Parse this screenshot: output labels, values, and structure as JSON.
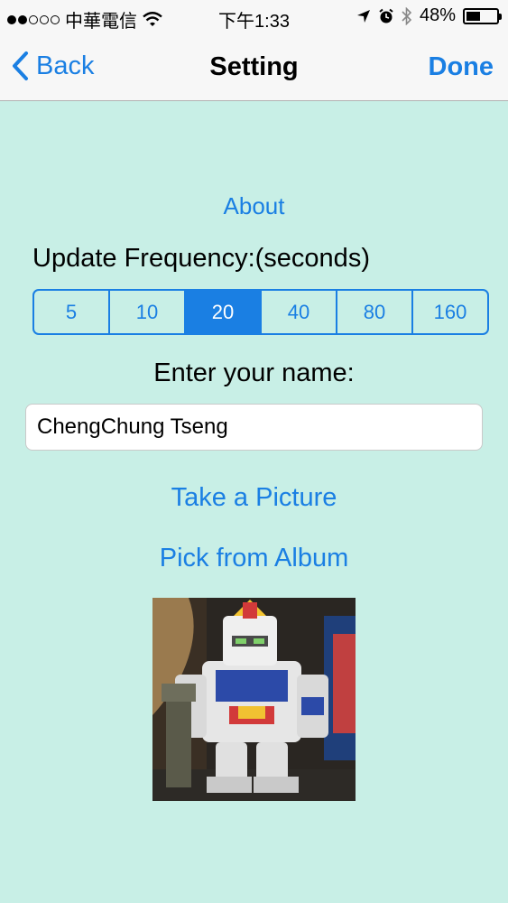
{
  "status_bar": {
    "carrier": "中華電信",
    "time": "下午1:33",
    "battery": "48%",
    "battery_level": 0.48,
    "signal_filled": 2,
    "signal_total": 5,
    "icons": [
      "wifi-icon",
      "location-arrow-icon",
      "alarm-icon",
      "bluetooth-icon",
      "battery-icon"
    ]
  },
  "nav": {
    "back_label": "Back",
    "title": "Setting",
    "done_label": "Done"
  },
  "content": {
    "about_label": "About",
    "frequency_label": "Update Frequency:(seconds)",
    "frequency_options": [
      "5",
      "10",
      "20",
      "40",
      "80",
      "160"
    ],
    "frequency_selected": "20",
    "name_label": "Enter your name:",
    "name_value": "ChengChung Tseng",
    "take_picture_label": "Take a Picture",
    "pick_album_label": "Pick from Album",
    "photo_subject": "robot-figure-photo"
  },
  "colors": {
    "accent": "#1a7fe3",
    "background": "#c8efe6",
    "bar_background": "#f7f7f7"
  }
}
